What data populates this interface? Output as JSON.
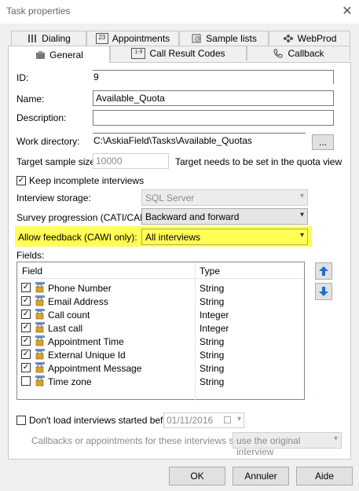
{
  "window": {
    "title": "Task properties",
    "close_glyph": "✕"
  },
  "tabs": {
    "row_top": [
      {
        "label": "Dialing",
        "icon": "dialing-icon"
      },
      {
        "label": "Appointments",
        "icon": "calendar-icon",
        "icon_text": "23"
      },
      {
        "label": "Sample lists",
        "icon": "sample-list-icon"
      },
      {
        "label": "WebProd",
        "icon": "webprod-icon"
      }
    ],
    "row_bottom": [
      {
        "label": "General",
        "icon": "general-icon",
        "active": true
      },
      {
        "label": "Call Result Codes",
        "icon": "call-result-icon",
        "icon_text": "1-9"
      },
      {
        "label": "Callback",
        "icon": "phone-icon"
      }
    ]
  },
  "form": {
    "id_label": "ID:",
    "id_value": "9",
    "name_label": "Name:",
    "name_value": "Available_Quota",
    "description_label": "Description:",
    "description_value": "",
    "workdir_label": "Work directory:",
    "workdir_value": "C:\\AskiaField\\Tasks\\Available_Quotas",
    "browse_label": "...",
    "target_label": "Target sample size:",
    "target_value": "10000",
    "target_note": "Target needs to be set in the quota view",
    "keep_incomplete_label": "Keep incomplete interviews",
    "keep_incomplete_checked": true,
    "storage_label": "Interview storage:",
    "storage_value": "SQL Server",
    "progression_label": "Survey progression (CATI/CAPI):",
    "progression_value": "Backward and forward",
    "feedback_label": "Allow feedback (CAWI only):",
    "feedback_value": "All interviews",
    "fields_label": "Fields:"
  },
  "fields_list": {
    "columns": [
      "Field",
      "Type"
    ],
    "rows": [
      {
        "name": "Phone Number",
        "type": "String",
        "checked": true
      },
      {
        "name": "Email Address",
        "type": "String",
        "checked": true
      },
      {
        "name": "Call count",
        "type": "Integer",
        "checked": true
      },
      {
        "name": "Last call",
        "type": "Integer",
        "checked": true
      },
      {
        "name": "Appointment Time",
        "type": "String",
        "checked": true
      },
      {
        "name": "External Unique Id",
        "type": "String",
        "checked": true
      },
      {
        "name": "Appointment Message",
        "type": "String",
        "checked": true
      },
      {
        "name": "Time zone",
        "type": "String",
        "checked": false
      }
    ]
  },
  "bottom": {
    "dont_load_label": "Don't load interviews started before",
    "dont_load_checked": false,
    "date_value": "01/11/2016",
    "callbacks_label": "Callbacks or appointments for these interviews should",
    "callbacks_value": "use the original interview"
  },
  "buttons": {
    "ok": "OK",
    "cancel": "Annuler",
    "help": "Aide"
  },
  "colors": {
    "highlight": "#ffff55",
    "arrow_blue": "#1e6fd0"
  }
}
